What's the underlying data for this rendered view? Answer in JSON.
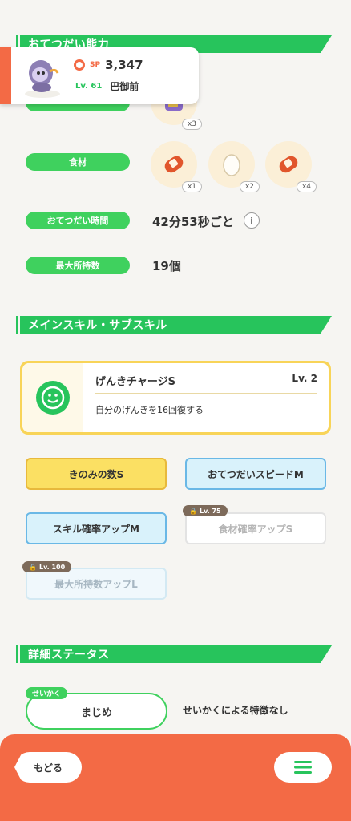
{
  "sections": {
    "help_ability": "おてつだい能力",
    "skills": "メインスキル・サブスキル",
    "detail_status": "詳細ステータス"
  },
  "pokemon": {
    "sp_label": "SP",
    "sp_value": "3,347",
    "level": "Lv. 61",
    "name": "巴御前"
  },
  "berry_row": {
    "count": "x3"
  },
  "ingredients": {
    "label": "食材",
    "items": [
      {
        "icon": "sausage-icon",
        "count": "x1"
      },
      {
        "icon": "egg-icon",
        "count": "x2"
      },
      {
        "icon": "sausage-icon",
        "count": "x4"
      }
    ]
  },
  "help_time": {
    "label": "おてつだい時間",
    "value": "42分53秒ごと",
    "info": "i"
  },
  "max_carry": {
    "label": "最大所持数",
    "value": "19個"
  },
  "main_skill": {
    "name": "げんきチャージS",
    "level": "Lv. 2",
    "description": "自分のげんきを16回復する"
  },
  "sub_skills": [
    {
      "label": "きのみの数S",
      "style": "yellow"
    },
    {
      "label": "おてつだいスピードM",
      "style": "blue"
    },
    {
      "label": "スキル確率アップM",
      "style": "blue"
    },
    {
      "label": "食材確率アップS",
      "style": "locked",
      "lock": "Lv. 75"
    },
    {
      "label": "最大所持数アップL",
      "style": "locked",
      "lock": "Lv. 100"
    }
  ],
  "nature": {
    "tag": "せいかく",
    "value": "まじめ",
    "effect": "せいかくによる特徴なし"
  },
  "nav": {
    "back": "もどる"
  },
  "colors": {
    "accent_green": "#27c45c",
    "accent_orange": "#f36a45",
    "gold": "#f8d458"
  }
}
